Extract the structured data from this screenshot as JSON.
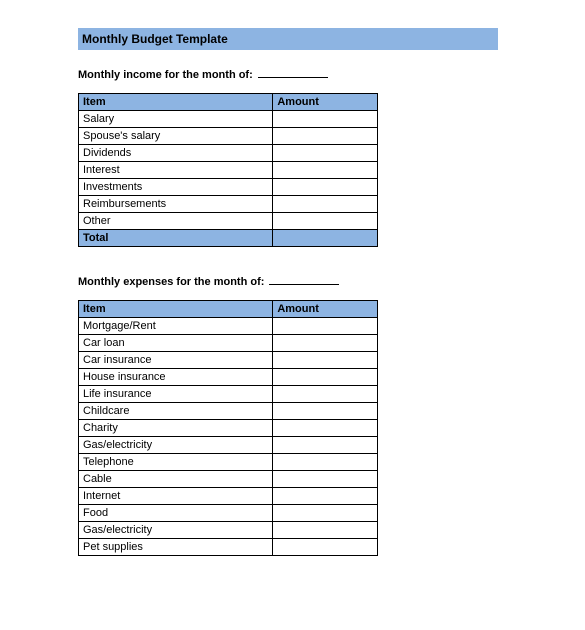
{
  "title": "Monthly Budget Template",
  "income": {
    "heading": "Monthly income for the month of:",
    "headers": {
      "item": "Item",
      "amount": "Amount"
    },
    "rows": [
      {
        "item": "Salary",
        "amount": ""
      },
      {
        "item": "Spouse's salary",
        "amount": ""
      },
      {
        "item": "Dividends",
        "amount": ""
      },
      {
        "item": "Interest",
        "amount": ""
      },
      {
        "item": "Investments",
        "amount": ""
      },
      {
        "item": "Reimbursements",
        "amount": ""
      },
      {
        "item": "Other",
        "amount": ""
      }
    ],
    "total_label": "Total",
    "total_amount": ""
  },
  "expenses": {
    "heading": "Monthly expenses for the month of:",
    "headers": {
      "item": "Item",
      "amount": "Amount"
    },
    "rows": [
      {
        "item": "Mortgage/Rent",
        "amount": ""
      },
      {
        "item": "Car loan",
        "amount": ""
      },
      {
        "item": "Car insurance",
        "amount": ""
      },
      {
        "item": "House insurance",
        "amount": ""
      },
      {
        "item": "Life insurance",
        "amount": ""
      },
      {
        "item": "Childcare",
        "amount": ""
      },
      {
        "item": "Charity",
        "amount": ""
      },
      {
        "item": "Gas/electricity",
        "amount": ""
      },
      {
        "item": "Telephone",
        "amount": ""
      },
      {
        "item": "Cable",
        "amount": ""
      },
      {
        "item": "Internet",
        "amount": ""
      },
      {
        "item": "Food",
        "amount": ""
      },
      {
        "item": "Gas/electricity",
        "amount": ""
      },
      {
        "item": "Pet supplies",
        "amount": ""
      }
    ]
  }
}
